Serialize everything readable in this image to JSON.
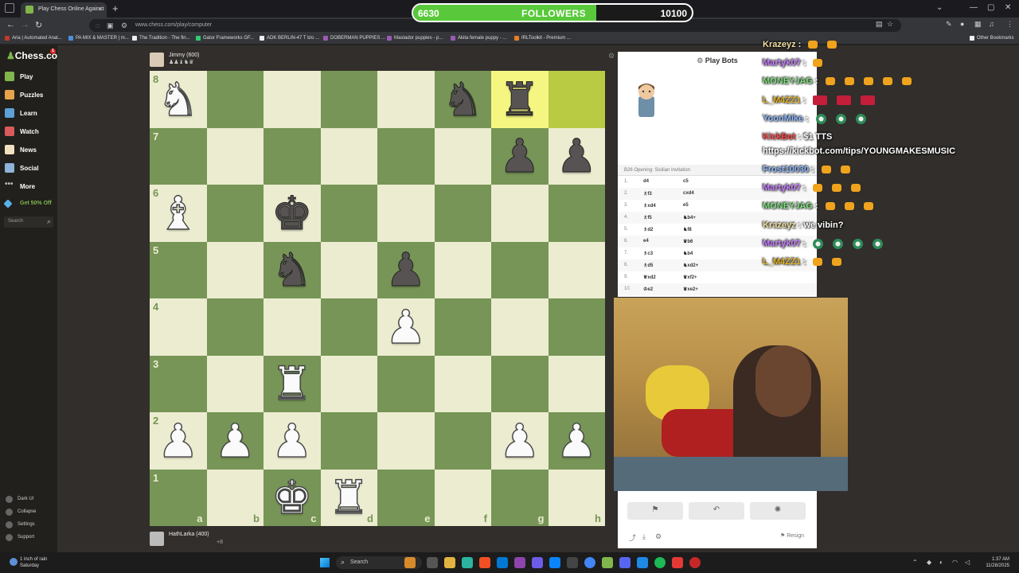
{
  "browser": {
    "tab_title": "Play Chess Online Against",
    "url": "www.chess.com/play/computer",
    "bookmarks": [
      "Aria | Automated Anal...",
      "PA MIX & MASTER | m...",
      "The Tradition - The fin...",
      "Gator Frameworks GF...",
      "ADK BERLIN-47 T b/o ...",
      "DOBERMAN PUPPIES ...",
      "Mastador puppies - p...",
      "Akita female puppy - ...",
      "IRLToolkit - Premium ..."
    ],
    "other_bookmarks": "Other Bookmarks"
  },
  "sidebar": {
    "logo": "Chess.com",
    "notif_count": "1",
    "items": [
      {
        "label": "Play",
        "color": "#81b64c"
      },
      {
        "label": "Puzzles",
        "color": "#e7a34a"
      },
      {
        "label": "Learn",
        "color": "#5ea0d8"
      },
      {
        "label": "Watch",
        "color": "#d95b5b"
      },
      {
        "label": "News",
        "color": "#f0e0c0"
      },
      {
        "label": "Social",
        "color": "#8fb3d9"
      },
      {
        "label": "More",
        "color": "#bbbbbb"
      }
    ],
    "promo": "Get 50% Off",
    "search_placeholder": "Search",
    "bottom": [
      "Dark UI",
      "Collapse",
      "Settings",
      "Support"
    ]
  },
  "game": {
    "top_player": {
      "name": "Jimmy (600)",
      "flag": "US",
      "captures": "♟♟♝♞♛"
    },
    "bottom_player": {
      "name": "HathLarka (400)",
      "flag": "US",
      "material": "+8"
    },
    "board": [
      [
        "wN",
        "",
        "",
        "",
        "",
        "bN",
        "bR",
        ""
      ],
      [
        "",
        "",
        "",
        "",
        "",
        "",
        "bP",
        "bP"
      ],
      [
        "wB",
        "",
        "bK",
        "",
        "",
        "",
        "",
        ""
      ],
      [
        "",
        "",
        "bN",
        "",
        "bP",
        "",
        "",
        ""
      ],
      [
        "",
        "",
        "",
        "",
        "wP",
        "",
        "",
        ""
      ],
      [
        "",
        "",
        "wR",
        "",
        "",
        "",
        "",
        ""
      ],
      [
        "wP",
        "wP",
        "wP",
        "",
        "",
        "",
        "wP",
        "wP"
      ],
      [
        "",
        "",
        "wK",
        "wR",
        "",
        "",
        "",
        ""
      ]
    ],
    "highlight": [
      "g8",
      "h8"
    ],
    "ranks": [
      "8",
      "7",
      "6",
      "5",
      "4",
      "3",
      "2",
      "1"
    ],
    "files": [
      "a",
      "b",
      "c",
      "d",
      "e",
      "f",
      "g",
      "h"
    ]
  },
  "panel": {
    "title": "Play Bots",
    "opening": "B26 Opening: Sicilian Invitation",
    "moves": [
      {
        "n": "1.",
        "w": "d4",
        "b": "c5"
      },
      {
        "n": "2.",
        "w": "♗f3",
        "b": "cxd4"
      },
      {
        "n": "3.",
        "w": "♗xd4",
        "b": "e5"
      },
      {
        "n": "4.",
        "w": "♗f5",
        "b": "♞b4+"
      },
      {
        "n": "5.",
        "w": "♗d2",
        "b": "♞f8"
      },
      {
        "n": "6.",
        "w": "e4",
        "b": "♛b6"
      },
      {
        "n": "7.",
        "w": "♗c3",
        "b": "♞b4"
      },
      {
        "n": "8.",
        "w": "♗d5",
        "b": "♞xd2+"
      },
      {
        "n": "9.",
        "w": "♕xd2",
        "b": "♛xf2+"
      },
      {
        "n": "10.",
        "w": "♔e2",
        "b": "♛xe2+"
      }
    ],
    "resign": "Resign"
  },
  "overlay": {
    "followers_current": "6630",
    "followers_label": "FOLLOWERS",
    "followers_goal": "10100",
    "followers_progress": 0.656
  },
  "chat": [
    {
      "user": "Krazeyz",
      "color": "#f0e0a0",
      "text": "",
      "emotes": [
        "w",
        "w"
      ]
    },
    {
      "user": "Martyk07",
      "color": "#c77dff",
      "text": "",
      "emotes": [
        "w"
      ]
    },
    {
      "user": "MONEYJAG",
      "color": "#7ee07e",
      "text": "",
      "emotes": [
        "w",
        "w",
        "w",
        "w",
        "w"
      ]
    },
    {
      "user": "L_M4ZZ1",
      "color": "#e6b422",
      "text": "",
      "emotes": [
        "f",
        "f",
        "f"
      ]
    },
    {
      "user": "YoonMike",
      "color": "#8fb8ff",
      "text": "",
      "emotes": [
        "g",
        "g",
        "g"
      ]
    },
    {
      "user": "KickBot",
      "color": "#ff4444",
      "text": "$1 TTS",
      "emotes": []
    },
    {
      "user": "",
      "color": "#ffffff",
      "text": "https://kickbot.com/tips/YOUNGMAKESMUSIC",
      "emotes": []
    },
    {
      "user": "Frost10030",
      "color": "#8fb8ff",
      "text": "",
      "emotes": [
        "w",
        "w"
      ]
    },
    {
      "user": "Martyk07",
      "color": "#c77dff",
      "text": "",
      "emotes": [
        "w",
        "w",
        "w"
      ]
    },
    {
      "user": "MONEYJAG",
      "color": "#7ee07e",
      "text": "",
      "emotes": [
        "w",
        "w",
        "w"
      ]
    },
    {
      "user": "Krazeyz",
      "color": "#f0e0a0",
      "text": "we vibin?",
      "emotes": []
    },
    {
      "user": "Martyk07",
      "color": "#c77dff",
      "text": "",
      "emotes": [
        "g",
        "g",
        "g",
        "g"
      ]
    },
    {
      "user": "L_M4ZZ1",
      "color": "#e6b422",
      "text": "",
      "emotes": [
        "w",
        "w"
      ]
    }
  ],
  "taskbar": {
    "weather_line1": "1 inch of rain",
    "weather_line2": "Saturday",
    "search": "Search",
    "time": "1:37 AM",
    "date": "11/28/2025"
  }
}
